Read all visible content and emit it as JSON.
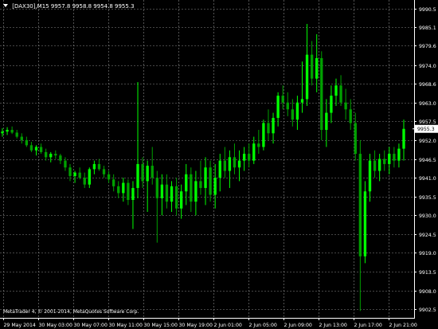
{
  "header": {
    "symbol": "[DAX30],M15",
    "ohlc": "9957.8 9958.8 9954.8 9955.3",
    "menu_icon": "triangle-down-icon"
  },
  "copyright": "MetaTrader 4, © 2001-2014, MetaQuotes Software Corp.",
  "colors": {
    "background": "#000000",
    "grid": "#8a8a8a",
    "bull": "#00ff00",
    "bear": "#00a000",
    "axis_text": "#ffffff",
    "price_label_bg": "#ffffff",
    "price_label_text": "#000000"
  },
  "chart_data": {
    "type": "candlestick",
    "symbol": "[DAX30]",
    "timeframe": "M15",
    "current_price": "9955.3",
    "y_ticks": [
      "9990.5",
      "9985.1",
      "9979.6",
      "9974.0",
      "9968.6",
      "9963.0",
      "9957.5",
      "9952.0",
      "9946.5",
      "9941.0",
      "9935.5",
      "9930.0",
      "9924.5",
      "9919.0",
      "9913.5",
      "9908.0",
      "9902.5"
    ],
    "ylim": [
      9900,
      9993
    ],
    "x_ticks": [
      "29 May 2014",
      "30 May 03:00",
      "30 May 07:00",
      "30 May 11:00",
      "30 May 15:00",
      "30 May 19:00",
      "2 Jun 01:00",
      "2 Jun 05:00",
      "2 Jun 09:00",
      "2 Jun 13:00",
      "2 Jun 17:00",
      "2 Jun 21:00"
    ],
    "grid": true,
    "candles": [
      [
        9954.0,
        9955.5,
        9953.0,
        9954.5
      ],
      [
        9954.5,
        9955.8,
        9953.5,
        9955.0
      ],
      [
        9955.0,
        9956.0,
        9953.8,
        9954.2
      ],
      [
        9954.2,
        9955.0,
        9952.5,
        9953.0
      ],
      [
        9953.0,
        9954.0,
        9951.0,
        9952.0
      ],
      [
        9952.0,
        9953.0,
        9950.0,
        9950.5
      ],
      [
        9950.5,
        9951.5,
        9948.5,
        9949.0
      ],
      [
        9949.0,
        9950.5,
        9947.5,
        9950.0
      ],
      [
        9950.0,
        9951.0,
        9948.0,
        9948.5
      ],
      [
        9948.5,
        9949.5,
        9946.0,
        9947.0
      ],
      [
        9947.0,
        9948.5,
        9945.5,
        9948.0
      ],
      [
        9948.0,
        9949.0,
        9946.5,
        9947.5
      ],
      [
        9947.5,
        9948.0,
        9945.0,
        9946.0
      ],
      [
        9946.0,
        9947.0,
        9943.0,
        9944.0
      ],
      [
        9944.0,
        9945.0,
        9940.0,
        9941.5
      ],
      [
        9941.5,
        9943.0,
        9939.5,
        9942.5
      ],
      [
        9942.5,
        9944.0,
        9940.5,
        9941.0
      ],
      [
        9941.0,
        9942.5,
        9938.0,
        9939.0
      ],
      [
        9939.0,
        9944.0,
        9938.0,
        9943.5
      ],
      [
        9943.5,
        9946.0,
        9942.0,
        9945.0
      ],
      [
        9945.0,
        9946.5,
        9943.0,
        9943.5
      ],
      [
        9943.5,
        9944.5,
        9941.0,
        9942.0
      ],
      [
        9942.0,
        9943.0,
        9939.5,
        9940.5
      ],
      [
        9940.5,
        9942.0,
        9937.0,
        9938.5
      ],
      [
        9938.5,
        9940.0,
        9935.0,
        9936.5
      ],
      [
        9936.5,
        9941.0,
        9934.0,
        9939.5
      ],
      [
        9939.5,
        9940.5,
        9933.0,
        9934.5
      ],
      [
        9934.5,
        9940.0,
        9926.0,
        9938.0
      ],
      [
        9938.0,
        9969.0,
        9935.0,
        9945.0
      ],
      [
        9945.0,
        9947.0,
        9938.0,
        9940.0
      ],
      [
        9940.0,
        9946.0,
        9931.0,
        9944.5
      ],
      [
        9944.5,
        9950.0,
        9939.0,
        9941.0
      ],
      [
        9941.0,
        9943.0,
        9922.0,
        9935.0
      ],
      [
        9935.0,
        9942.0,
        9930.0,
        9939.0
      ],
      [
        9939.0,
        9942.0,
        9932.0,
        9934.0
      ],
      [
        9934.0,
        9940.0,
        9931.0,
        9938.5
      ],
      [
        9938.5,
        9941.0,
        9930.0,
        9932.0
      ],
      [
        9932.0,
        9939.0,
        9929.0,
        9937.0
      ],
      [
        9937.0,
        9945.0,
        9933.0,
        9942.0
      ],
      [
        9942.0,
        9944.0,
        9931.0,
        9934.0
      ],
      [
        9934.0,
        9943.0,
        9930.0,
        9940.0
      ],
      [
        9940.0,
        9946.0,
        9936.0,
        9938.0
      ],
      [
        9938.0,
        9947.0,
        9933.0,
        9944.0
      ],
      [
        9944.0,
        9946.0,
        9934.0,
        9936.0
      ],
      [
        9936.0,
        9945.0,
        9932.0,
        9941.0
      ],
      [
        9941.0,
        9948.0,
        9937.0,
        9946.0
      ],
      [
        9946.0,
        9950.0,
        9941.0,
        9943.0
      ],
      [
        9943.0,
        9949.0,
        9938.0,
        9947.0
      ],
      [
        9947.0,
        9951.0,
        9942.0,
        9944.0
      ],
      [
        9944.0,
        9949.0,
        9940.0,
        9946.0
      ],
      [
        9946.0,
        9950.0,
        9943.0,
        9948.0
      ],
      [
        9948.0,
        9951.0,
        9944.0,
        9946.0
      ],
      [
        9946.0,
        9953.0,
        9945.0,
        9951.0
      ],
      [
        9951.0,
        9955.0,
        9948.0,
        9950.0
      ],
      [
        9950.0,
        9958.0,
        9949.0,
        9957.0
      ],
      [
        9957.0,
        9961.0,
        9952.0,
        9954.0
      ],
      [
        9954.0,
        9960.0,
        9951.0,
        9958.5
      ],
      [
        9958.5,
        9966.0,
        9956.0,
        9965.0
      ],
      [
        9965.0,
        9968.0,
        9961.0,
        9963.0
      ],
      [
        9963.0,
        9966.0,
        9959.0,
        9961.0
      ],
      [
        9961.0,
        9964.0,
        9956.0,
        9958.0
      ],
      [
        9958.0,
        9965.0,
        9955.0,
        9963.0
      ],
      [
        9963.0,
        9975.0,
        9960.0,
        9964.0
      ],
      [
        9964.0,
        9986.0,
        9962.0,
        9977.0
      ],
      [
        9977.0,
        9981.0,
        9968.0,
        9970.0
      ],
      [
        9970.0,
        9983.0,
        9966.0,
        9976.0
      ],
      [
        9976.0,
        9978.0,
        9952.0,
        9955.0
      ],
      [
        9955.0,
        9964.0,
        9950.0,
        9960.0
      ],
      [
        9960.0,
        9968.0,
        9957.0,
        9965.0
      ],
      [
        9965.0,
        9970.0,
        9962.0,
        9968.0
      ],
      [
        9968.0,
        9971.0,
        9962.0,
        9963.0
      ],
      [
        9963.0,
        9967.0,
        9958.0,
        9961.0
      ],
      [
        9961.0,
        9964.0,
        9955.0,
        9957.0
      ],
      [
        9957.0,
        9960.0,
        9946.0,
        9948.0
      ],
      [
        9948.0,
        9952.0,
        9902.0,
        9918.0
      ],
      [
        9918.0,
        9940.0,
        9916.0,
        9937.0
      ],
      [
        9937.0,
        9948.0,
        9934.0,
        9946.0
      ],
      [
        9946.0,
        9949.0,
        9941.0,
        9943.0
      ],
      [
        9943.0,
        9948.0,
        9940.0,
        9946.5
      ],
      [
        9946.5,
        9949.0,
        9943.0,
        9945.0
      ],
      [
        9945.0,
        9950.0,
        9942.0,
        9948.0
      ],
      [
        9948.0,
        9950.0,
        9944.0,
        9946.0
      ],
      [
        9946.0,
        9951.0,
        9944.0,
        9949.5
      ],
      [
        9949.5,
        9958.0,
        9946.0,
        9955.3
      ]
    ]
  }
}
